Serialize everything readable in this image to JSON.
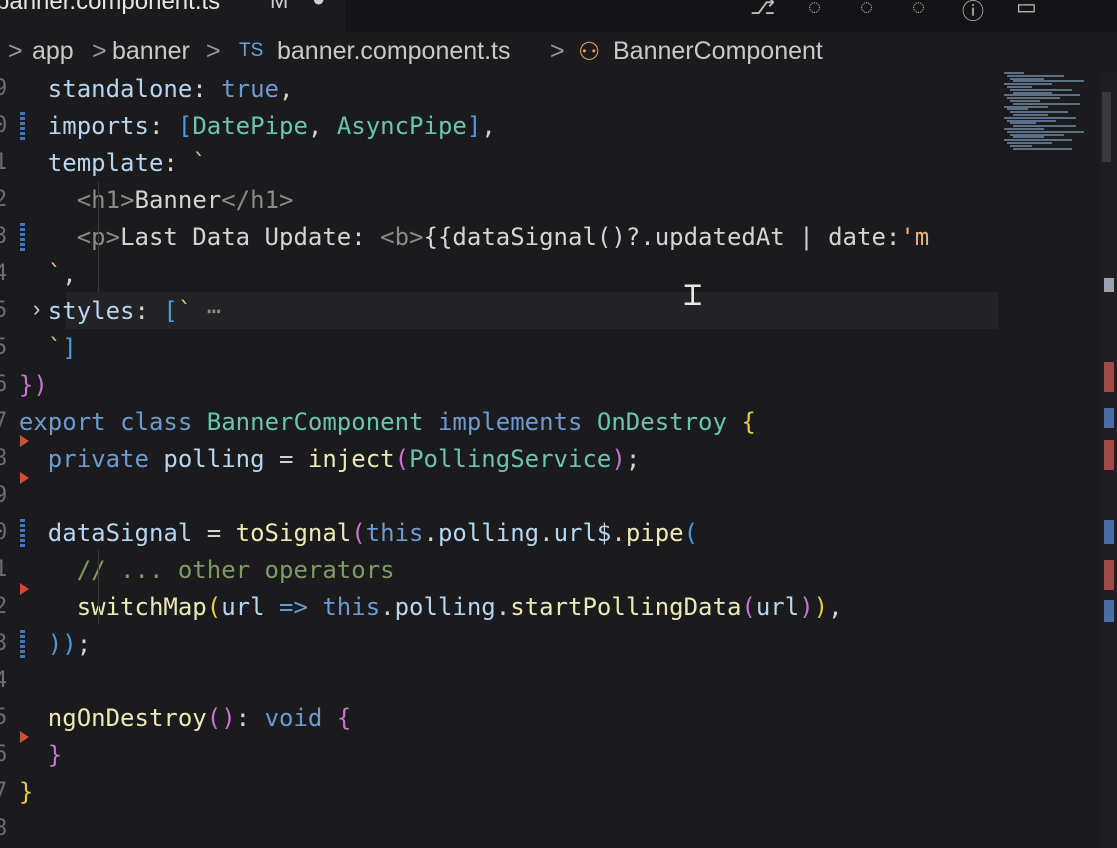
{
  "tab": {
    "filename": "banner.component.ts",
    "modified": "M",
    "close": "●"
  },
  "breadcrumb": {
    "items": [
      "app",
      "banner",
      "banner.component.ts",
      "BannerComponent"
    ],
    "ts_badge": "TS",
    "separator": ">"
  },
  "line_numbers": [
    "9",
    "0",
    "1",
    "2",
    "3",
    "4",
    "5",
    "5",
    "6",
    "7",
    "8",
    "9",
    "0",
    "1",
    "2",
    "3",
    "4",
    "5",
    "6",
    "7",
    "8"
  ],
  "colors": {
    "keyword": "#6d9ad3",
    "property": "#b7d5f0",
    "function": "#ece9b4",
    "string": "#e8b37a",
    "comment": "#7e9b63",
    "brace_yellow": "#e6c94a",
    "brace_purple": "#c774d0",
    "brace_blue": "#4a9be0",
    "tag": "#8a8a8a",
    "text": "#d4d4d4"
  },
  "code": [
    [
      [
        "    ",
        "text"
      ],
      [
        "standalone",
        "property"
      ],
      [
        ": ",
        "text"
      ],
      [
        "true",
        "keyword"
      ],
      [
        ",",
        "text"
      ]
    ],
    [
      [
        "    ",
        "text"
      ],
      [
        "imports",
        "property"
      ],
      [
        ": ",
        "text"
      ],
      [
        "[",
        "brace_blue"
      ],
      [
        "DatePipe",
        "type"
      ],
      [
        ", ",
        "text"
      ],
      [
        "AsyncPipe",
        "type"
      ],
      [
        "]",
        "brace_blue"
      ],
      [
        ",",
        "text"
      ]
    ],
    [
      [
        "    ",
        "text"
      ],
      [
        "template",
        "property"
      ],
      [
        ": ",
        "text"
      ],
      [
        "`",
        "string"
      ]
    ],
    [
      [
        "      ",
        "text"
      ],
      [
        "<",
        "tag"
      ],
      [
        "h1",
        "tag"
      ],
      [
        ">",
        "tag"
      ],
      [
        "Banner",
        "text"
      ],
      [
        "</",
        "tag"
      ],
      [
        "h1",
        "tag"
      ],
      [
        ">",
        "tag"
      ]
    ],
    [
      [
        "      ",
        "text"
      ],
      [
        "<",
        "tag"
      ],
      [
        "p",
        "tag"
      ],
      [
        ">",
        "tag"
      ],
      [
        "Last Data Update: ",
        "text"
      ],
      [
        "<",
        "tag"
      ],
      [
        "b",
        "tag"
      ],
      [
        ">",
        "tag"
      ],
      [
        "{{dataSignal",
        "text"
      ],
      [
        "()",
        "text"
      ],
      [
        "?.updatedAt | date:",
        "text"
      ],
      [
        "'m",
        "string"
      ]
    ],
    [
      [
        "    ",
        "text"
      ],
      [
        "`",
        "string"
      ],
      [
        ",",
        "text"
      ]
    ],
    [
      [
        "    ",
        "text"
      ],
      [
        "styles",
        "property"
      ],
      [
        ": ",
        "text"
      ],
      [
        "[",
        "brace_blue"
      ],
      [
        "`",
        "string"
      ],
      [
        " ⋯",
        "tag"
      ]
    ],
    [
      [
        "    ",
        "text"
      ],
      [
        "`",
        "string"
      ],
      [
        "]",
        "brace_blue"
      ]
    ],
    [
      [
        "  ",
        "text"
      ],
      [
        "})",
        "brace_purple"
      ]
    ],
    [
      [
        "  ",
        "text"
      ],
      [
        "export ",
        "keyword"
      ],
      [
        "class ",
        "keyword"
      ],
      [
        "BannerComponent ",
        "type"
      ],
      [
        "implements ",
        "keyword"
      ],
      [
        "OnDestroy ",
        "type"
      ],
      [
        "{",
        "brace_yellow"
      ]
    ],
    [
      [
        "    ",
        "text"
      ],
      [
        "private ",
        "keyword"
      ],
      [
        "polling",
        "property"
      ],
      [
        " = ",
        "text"
      ],
      [
        "inject",
        "function"
      ],
      [
        "(",
        "brace_purple"
      ],
      [
        "PollingService",
        "type"
      ],
      [
        ")",
        "brace_purple"
      ],
      [
        ";",
        "text"
      ]
    ],
    [
      [
        "",
        "text"
      ]
    ],
    [
      [
        "    ",
        "text"
      ],
      [
        "dataSignal",
        "property"
      ],
      [
        " = ",
        "text"
      ],
      [
        "toSignal",
        "function"
      ],
      [
        "(",
        "brace_purple"
      ],
      [
        "this",
        "keyword"
      ],
      [
        ".",
        "text"
      ],
      [
        "polling",
        "property"
      ],
      [
        ".",
        "text"
      ],
      [
        "url$",
        "property"
      ],
      [
        ".",
        "text"
      ],
      [
        "pipe",
        "function"
      ],
      [
        "(",
        "brace_blue"
      ]
    ],
    [
      [
        "      ",
        "text"
      ],
      [
        "// ... other operators",
        "comment"
      ]
    ],
    [
      [
        "      ",
        "text"
      ],
      [
        "switchMap",
        "function"
      ],
      [
        "(",
        "brace_yellow"
      ],
      [
        "url",
        "property"
      ],
      [
        " => ",
        "keyword"
      ],
      [
        "this",
        "keyword"
      ],
      [
        ".",
        "text"
      ],
      [
        "polling",
        "property"
      ],
      [
        ".",
        "text"
      ],
      [
        "startPollingData",
        "function"
      ],
      [
        "(",
        "brace_purple"
      ],
      [
        "url",
        "property"
      ],
      [
        ")",
        "brace_purple"
      ],
      [
        ")",
        "brace_yellow"
      ],
      [
        ",",
        "text"
      ]
    ],
    [
      [
        "    ",
        "text"
      ],
      [
        "))",
        "brace_blue"
      ],
      [
        ";",
        "text"
      ]
    ],
    [
      [
        "",
        "text"
      ]
    ],
    [
      [
        "    ",
        "text"
      ],
      [
        "ngOnDestroy",
        "function"
      ],
      [
        "()",
        "brace_purple"
      ],
      [
        ": ",
        "text"
      ],
      [
        "void ",
        "keyword"
      ],
      [
        "{",
        "brace_purple"
      ]
    ],
    [
      [
        "    ",
        "text"
      ],
      [
        "}",
        "brace_purple"
      ]
    ],
    [
      [
        "  ",
        "text"
      ],
      [
        "}",
        "brace_yellow"
      ]
    ],
    [
      [
        "",
        "text"
      ]
    ]
  ]
}
